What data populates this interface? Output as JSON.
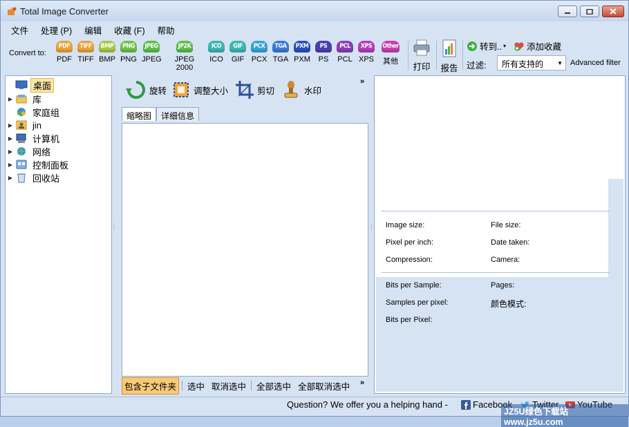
{
  "window": {
    "title": "Total Image Converter",
    "controls": {
      "minimize": "minimize",
      "maximize": "maximize",
      "close": "close"
    }
  },
  "menu": [
    "文件",
    "处理 (P)",
    "编辑",
    "收藏 (F)",
    "帮助"
  ],
  "toolbar": {
    "convert_label": "Convert to:",
    "formats": [
      {
        "badge": "PDF",
        "label": "PDF",
        "color": "#e8a33b"
      },
      {
        "badge": "TIFF",
        "label": "TIFF",
        "color": "#e8a33b"
      },
      {
        "badge": "BMP",
        "label": "BMP",
        "color": "#a6c74a"
      },
      {
        "badge": "PNG",
        "label": "PNG",
        "color": "#6fc04a"
      },
      {
        "badge": "JPEG",
        "label": "JPEG",
        "color": "#5fbd4a"
      },
      {
        "badge": "JP2K",
        "label": "JPEG 2000",
        "color": "#5fbd4a"
      },
      {
        "badge": "ICO",
        "label": "ICO",
        "color": "#3fb6b0"
      },
      {
        "badge": "GIF",
        "label": "GIF",
        "color": "#3fb6b0"
      },
      {
        "badge": "PCX",
        "label": "PCX",
        "color": "#3aa3d6"
      },
      {
        "badge": "TGA",
        "label": "TGA",
        "color": "#3a7ad6"
      },
      {
        "badge": "PXM",
        "label": "PXM",
        "color": "#2a4fb8"
      },
      {
        "badge": "PS",
        "label": "PS",
        "color": "#4a3fb0"
      },
      {
        "badge": "PCL",
        "label": "PCL",
        "color": "#8a3fb8"
      },
      {
        "badge": "XPS",
        "label": "XPS",
        "color": "#b23fb8"
      },
      {
        "badge": "Other",
        "label": "其他",
        "color": "#c83fb0"
      }
    ],
    "print_label": "打印",
    "report_label": "报告",
    "goto_label": "转到..",
    "add_fav_label": "添加收藏",
    "filter_label": "过滤:",
    "filter_value": "所有支持的",
    "advanced_filter": "Advanced filter"
  },
  "tree": [
    {
      "label": "桌面",
      "selected": true,
      "expandable": false,
      "icon": "desktop-icon"
    },
    {
      "label": "库",
      "selected": false,
      "expandable": true,
      "icon": "library-icon"
    },
    {
      "label": "家庭组",
      "selected": false,
      "expandable": false,
      "icon": "homegroup-icon"
    },
    {
      "label": "jin",
      "selected": false,
      "expandable": true,
      "icon": "user-folder-icon"
    },
    {
      "label": "计算机",
      "selected": false,
      "expandable": true,
      "icon": "computer-icon"
    },
    {
      "label": "网络",
      "selected": false,
      "expandable": true,
      "icon": "network-icon"
    },
    {
      "label": "控制面板",
      "selected": false,
      "expandable": true,
      "icon": "control-panel-icon"
    },
    {
      "label": "回收站",
      "selected": false,
      "expandable": true,
      "icon": "recycle-bin-icon"
    }
  ],
  "mid_tools": {
    "rotate": "旋转",
    "resize": "调整大小",
    "crop": "剪切",
    "watermark": "水印",
    "more": "»"
  },
  "tabs": [
    "缩略图",
    "详细信息"
  ],
  "bottom_actions": {
    "include_subfolders": "包含子文件夹",
    "select": "选中",
    "deselect": "取消选中",
    "select_all": "全部选中",
    "deselect_all": "全部取消选中",
    "more": "»"
  },
  "info": {
    "image_size": "Image size:",
    "file_size": "File size:",
    "pixel_per_inch": "Pixel per inch:",
    "date_taken": "Date taken:",
    "compression": "Compression:",
    "camera": "Camera:",
    "bits_per_sample": "Bits per Sample:",
    "pages": "Pages:",
    "samples_per_pixel": "Samples per pixel:",
    "color_mode": "颜色模式:",
    "bits_per_pixel": "Bits per Pixel:"
  },
  "status": {
    "question": "Question? We offer you a helping hand -",
    "facebook": "Facebook",
    "twitter": "Twitter",
    "youtube": "YouTube",
    "watermark_text": "JZ5U绿色下载站 www.jz5u.com"
  }
}
